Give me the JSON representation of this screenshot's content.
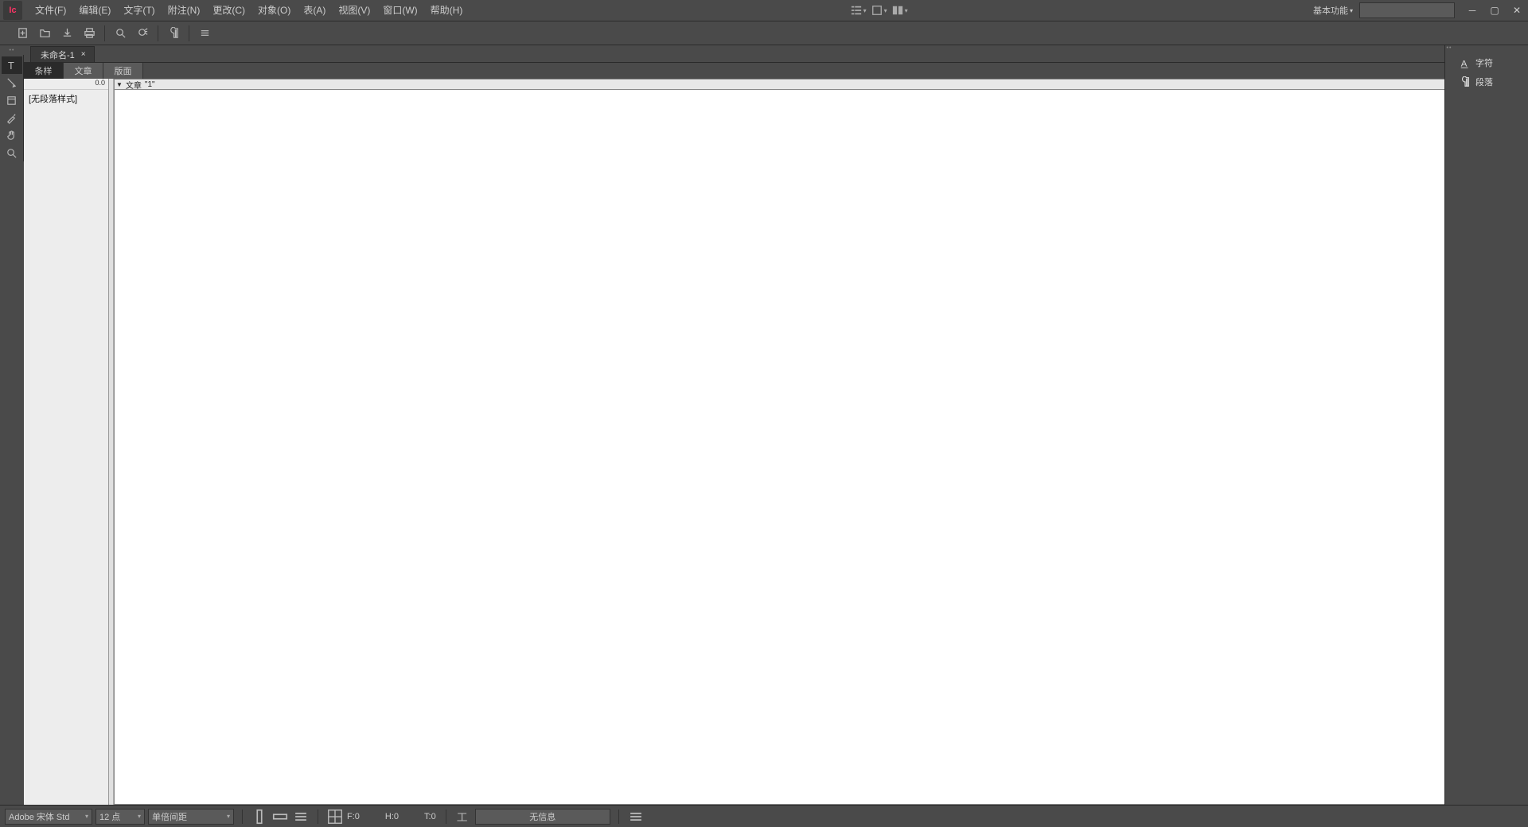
{
  "app": {
    "logo_text": "Ic"
  },
  "menu": {
    "file": "文件(F)",
    "edit": "编辑(E)",
    "type": "文字(T)",
    "notes": "附注(N)",
    "changes": "更改(C)",
    "object": "对象(O)",
    "table": "表(A)",
    "view": "视图(V)",
    "window": "窗口(W)",
    "help": "帮助(H)"
  },
  "workspace": {
    "label": "基本功能"
  },
  "doc_tab": {
    "title": "未命名-1"
  },
  "sub_tabs": {
    "galley": "条样",
    "story": "文章",
    "layout": "版面"
  },
  "styles": {
    "header": "0.0",
    "item1": "[无段落样式]"
  },
  "story_header": {
    "label": "文章",
    "id": "\"1\""
  },
  "right_panel": {
    "character": "字符",
    "paragraph": "段落"
  },
  "status": {
    "font": "Adobe 宋体 Std",
    "size": "12 点",
    "leading": "单倍间距",
    "f_label": "F:0",
    "h_label": "H:0",
    "t_label": "T:0",
    "info": "无信息"
  }
}
